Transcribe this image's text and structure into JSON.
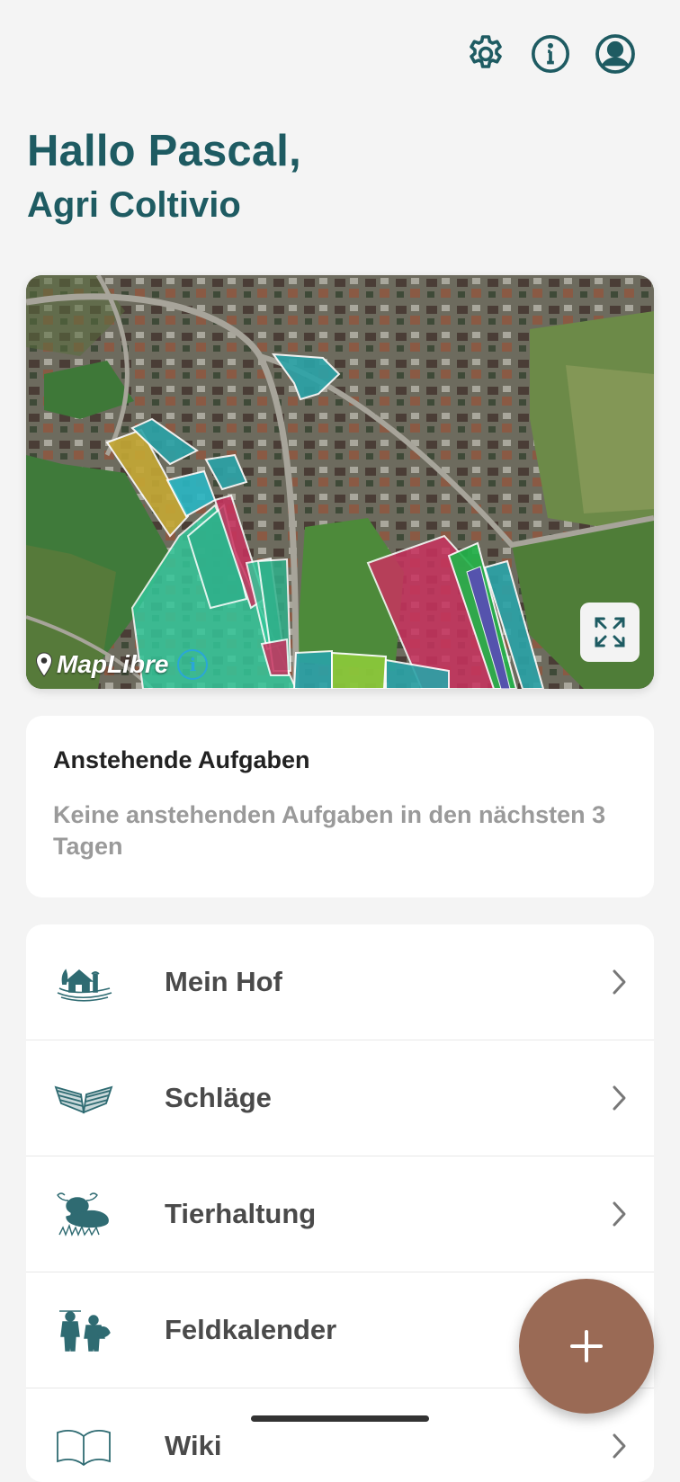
{
  "header": {
    "icons": [
      "gear-icon",
      "info-icon",
      "account-icon"
    ]
  },
  "greeting": {
    "title": "Hallo Pascal,",
    "subtitle": "Agri Coltivio"
  },
  "map": {
    "attribution": "MapLibre",
    "info_glyph": "i"
  },
  "tasks": {
    "title": "Anstehende Aufgaben",
    "empty_text": "Keine anstehenden Aufgaben in den nächsten 3 Tagen"
  },
  "menu": {
    "items": [
      {
        "label": "Mein Hof",
        "icon": "farm-icon"
      },
      {
        "label": "Schläge",
        "icon": "field-plots-icon"
      },
      {
        "label": "Tierhaltung",
        "icon": "cow-icon"
      },
      {
        "label": "Feldkalender",
        "icon": "farmers-icon"
      },
      {
        "label": "Wiki",
        "icon": "book-icon"
      }
    ]
  },
  "colors": {
    "primary": "#1e5b62",
    "fab": "#9a6a55",
    "background": "#f4f4f4"
  }
}
